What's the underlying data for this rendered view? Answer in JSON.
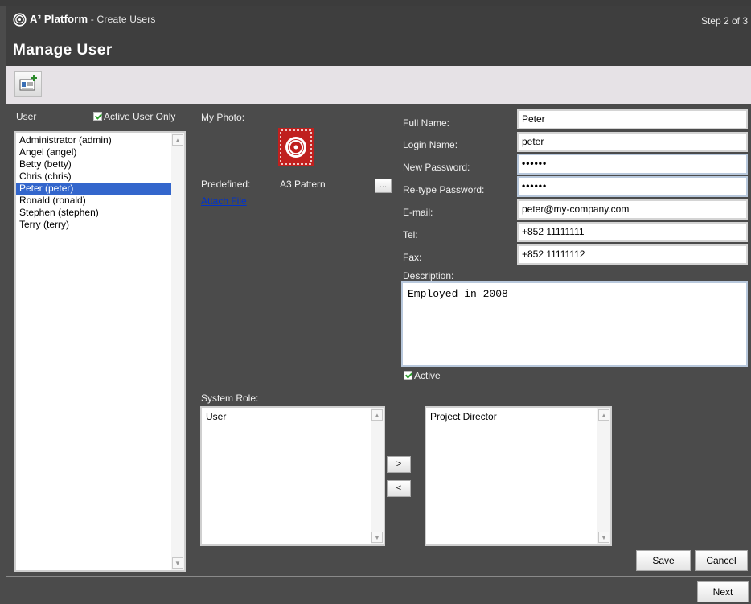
{
  "header": {
    "app_name": "A³ Platform",
    "app_subtitle": " - Create Users",
    "step": "Step 2 of 3",
    "page_title": "Manage User"
  },
  "toolbar": {
    "add_user_icon": "add-user-icon"
  },
  "user_list": {
    "label": "User",
    "active_only_label": "Active User Only",
    "active_only_checked": true,
    "items": [
      {
        "label": "Administrator (admin)",
        "selected": false
      },
      {
        "label": "Angel (angel)",
        "selected": false
      },
      {
        "label": "Betty (betty)",
        "selected": false
      },
      {
        "label": "Chris (chris)",
        "selected": false
      },
      {
        "label": "Peter (peter)",
        "selected": true
      },
      {
        "label": "Ronald (ronald)",
        "selected": false
      },
      {
        "label": "Stephen (stephen)",
        "selected": false
      },
      {
        "label": "Terry (terry)",
        "selected": false
      }
    ]
  },
  "photo": {
    "label": "My Photo:",
    "predefined_label": "Predefined:",
    "predefined_value": "A3 Pattern",
    "browse_label": "...",
    "attach_label": "Attach File",
    "photo_color": "#c0201e"
  },
  "form": {
    "full_name_label": "Full Name:",
    "full_name_value": "Peter",
    "login_name_label": "Login Name:",
    "login_name_value": "peter",
    "new_password_label": "New Password:",
    "new_password_value": "••••••",
    "retype_password_label": "Re-type Password:",
    "retype_password_value": "••••••",
    "email_label": "E-mail:",
    "email_value": "peter@my-company.com",
    "tel_label": "Tel:",
    "tel_value": "+852 11111111",
    "fax_label": "Fax:",
    "fax_value": "+852 11111112",
    "description_label": "Description:",
    "description_value": "Employed in 2008",
    "active_label": "Active",
    "active_checked": true
  },
  "roles": {
    "label": "System Role:",
    "available": [
      "User"
    ],
    "assigned": [
      "Project Director"
    ],
    "add_label": ">",
    "remove_label": "<"
  },
  "actions": {
    "save_label": "Save",
    "cancel_label": "Cancel",
    "next_label": "Next"
  },
  "colors": {
    "background": "#4b4b4b",
    "header": "#3e3e3e",
    "toolbar": "#e6e2e6",
    "selection": "#3366cc"
  }
}
